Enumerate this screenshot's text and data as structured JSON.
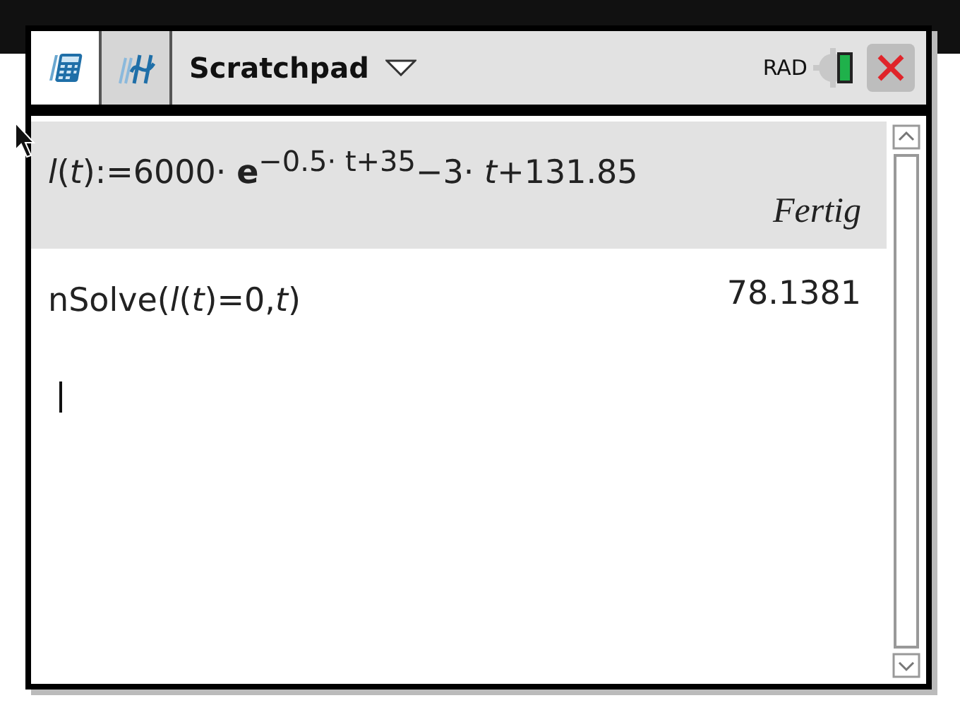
{
  "toolbar": {
    "tabs": [
      {
        "kind": "calculator",
        "selected": true
      },
      {
        "kind": "graphs",
        "selected": false
      }
    ],
    "title": "Scratchpad",
    "mode": "RAD"
  },
  "entries": [
    {
      "expression": "*l*(*t*):=6000· **e**$^{−0.5· t+35}$−3· *t*+131.85",
      "result": "Fertig",
      "kind": "message",
      "selected": true
    },
    {
      "expression": "nSolve(*l*(*t*)=0,*t*)",
      "result": "78.1381",
      "kind": "value",
      "selected": false
    }
  ]
}
